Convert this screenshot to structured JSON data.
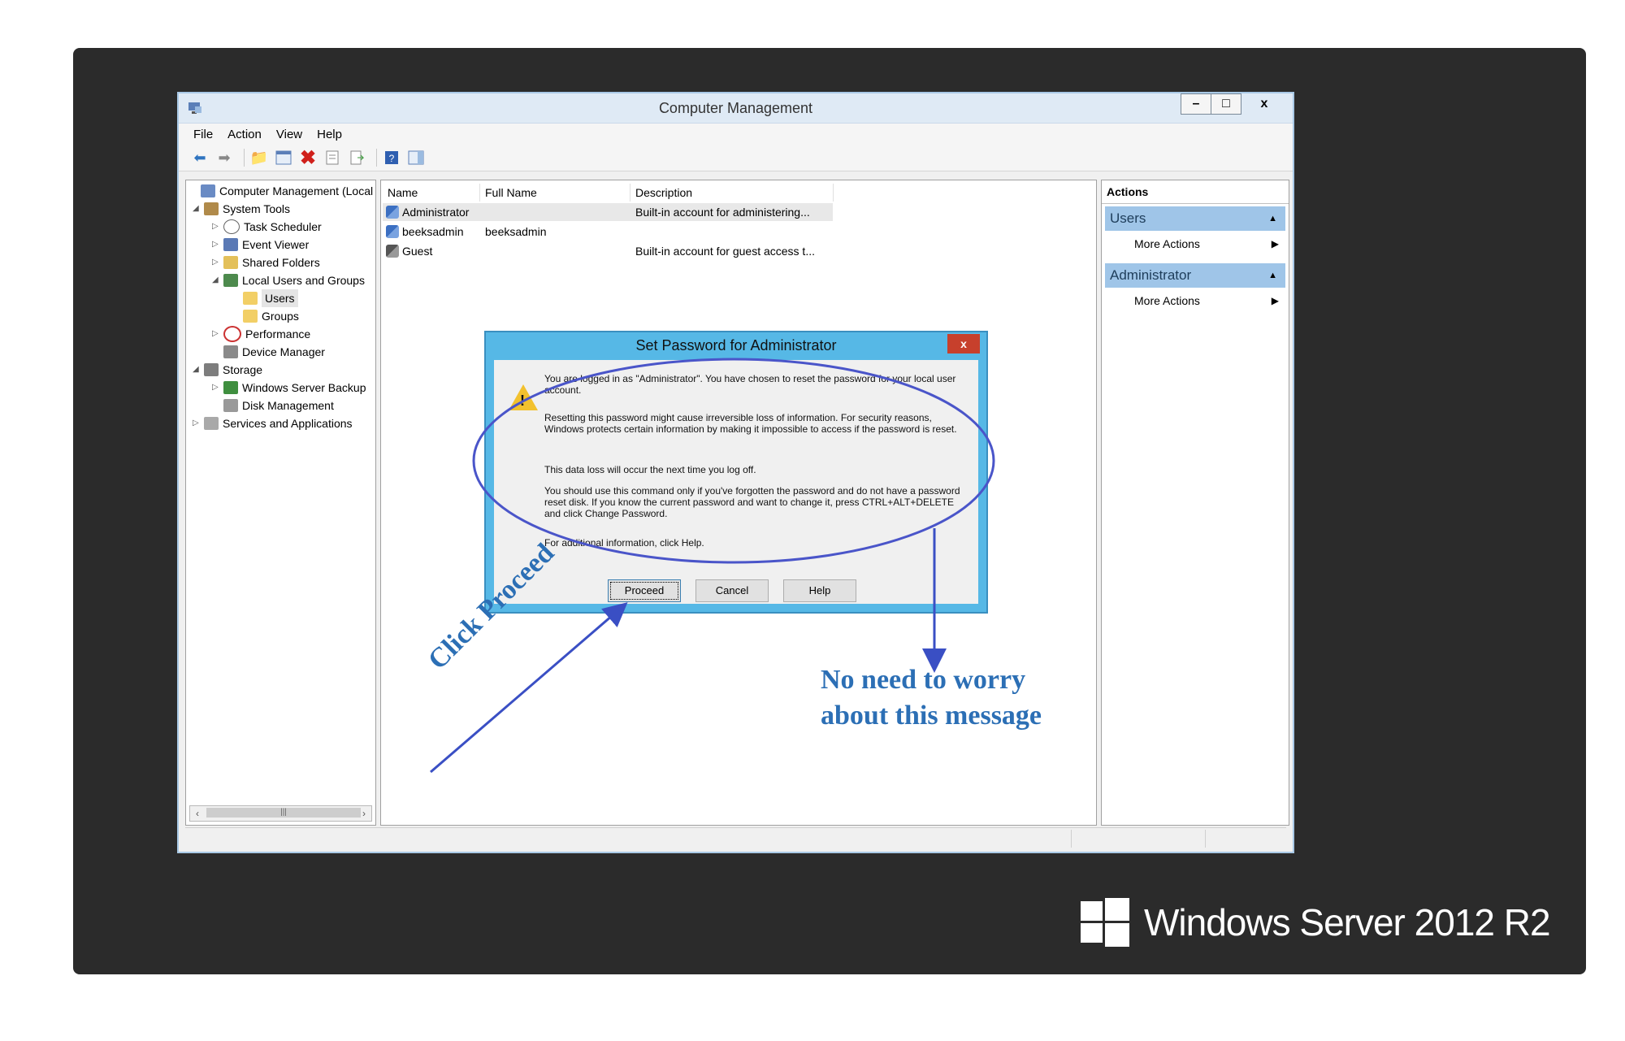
{
  "window": {
    "title": "Computer Management",
    "caption": {
      "minimize": "–",
      "maximize": "□",
      "close": "x"
    }
  },
  "menu": [
    "File",
    "Action",
    "View",
    "Help"
  ],
  "tree": [
    {
      "label": "Computer Management (Local",
      "expander": ""
    },
    {
      "label": "System Tools",
      "expander": "◢"
    },
    {
      "label": "Task Scheduler",
      "expander": "▷"
    },
    {
      "label": "Event Viewer",
      "expander": "▷"
    },
    {
      "label": "Shared Folders",
      "expander": "▷"
    },
    {
      "label": "Local Users and Groups",
      "expander": "◢"
    },
    {
      "label": "Users",
      "expander": ""
    },
    {
      "label": "Groups",
      "expander": ""
    },
    {
      "label": "Performance",
      "expander": "▷"
    },
    {
      "label": "Device Manager",
      "expander": ""
    },
    {
      "label": "Storage",
      "expander": "◢"
    },
    {
      "label": "Windows Server Backup",
      "expander": "▷"
    },
    {
      "label": "Disk Management",
      "expander": ""
    },
    {
      "label": "Services and Applications",
      "expander": "▷"
    }
  ],
  "list": {
    "columns": [
      "Name",
      "Full Name",
      "Description"
    ],
    "rows": [
      {
        "name": "Administrator",
        "full_name": "",
        "description": "Built-in account for administering..."
      },
      {
        "name": "beeksadmin",
        "full_name": "beeksadmin",
        "description": ""
      },
      {
        "name": "Guest",
        "full_name": "",
        "description": "Built-in account for guest access t..."
      }
    ]
  },
  "actions": {
    "title": "Actions",
    "sections": [
      {
        "title": "Users",
        "item": "More Actions"
      },
      {
        "title": "Administrator",
        "item": "More Actions"
      }
    ]
  },
  "dialog": {
    "title": "Set Password for Administrator",
    "close": "x",
    "paragraphs": [
      "You are logged in as \"Administrator\". You have chosen to reset the password for your local user account.",
      "Resetting this password might cause irreversible loss of information. For security reasons, Windows protects certain information by making it impossible to access if the password is reset.",
      "This data loss will occur the next time you log off.",
      "You should use this command only if you've forgotten the password and do not have a password reset disk. If you know the current password and want to change it, press CTRL+ALT+DELETE and click Change Password.",
      "For additional information, click Help."
    ],
    "buttons": [
      "Proceed",
      "Cancel",
      "Help"
    ]
  },
  "annotations": {
    "click_proceed": "Click Proceed",
    "no_need_line1": "No need to worry",
    "no_need_line2": "about this message",
    "color": "#2c6fb5"
  },
  "brand": {
    "name": "Windows Server 2012 R2"
  },
  "colors": {
    "frame": "#2b2b2b",
    "dialog_border": "#56b8e6",
    "action_header": "#9fc5e8",
    "close_red": "#c7402c"
  }
}
